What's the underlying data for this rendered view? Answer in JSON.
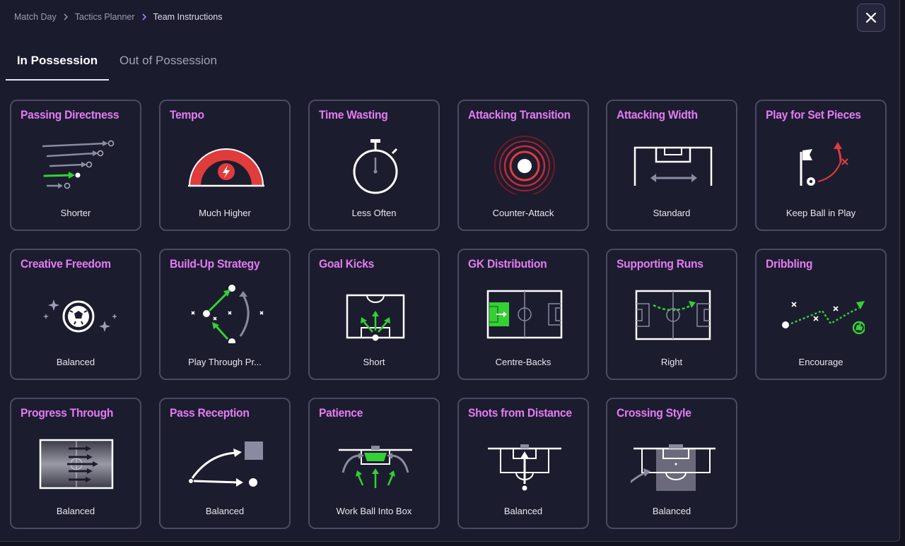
{
  "breadcrumb": [
    "Match Day",
    "Tactics Planner",
    "Team Instructions"
  ],
  "tabs": [
    {
      "label": "In Possession",
      "active": true
    },
    {
      "label": "Out of Possession",
      "active": false
    }
  ],
  "colors": {
    "accent": "#e27cf1",
    "green": "#33d133",
    "red": "#e03c3c",
    "background": "#1b1b2e"
  },
  "cards": [
    {
      "title": "Passing Directness",
      "value": "Shorter",
      "icon": "pass-arrows-icon"
    },
    {
      "title": "Tempo",
      "value": "Much Higher",
      "icon": "tempo-gauge-icon"
    },
    {
      "title": "Time Wasting",
      "value": "Less Often",
      "icon": "stopwatch-icon"
    },
    {
      "title": "Attacking Transition",
      "value": "Counter-Attack",
      "icon": "counter-attack-icon"
    },
    {
      "title": "Attacking Width",
      "value": "Standard",
      "icon": "width-icon"
    },
    {
      "title": "Play for Set Pieces",
      "value": "Keep Ball in Play",
      "icon": "set-piece-icon"
    },
    {
      "title": "Creative Freedom",
      "value": "Balanced",
      "icon": "creative-ball-icon"
    },
    {
      "title": "Build-Up Strategy",
      "value": "Play Through Pr...",
      "icon": "build-up-icon"
    },
    {
      "title": "Goal Kicks",
      "value": "Short",
      "icon": "goal-kick-icon"
    },
    {
      "title": "GK Distribution",
      "value": "Centre-Backs",
      "icon": "gk-distribution-icon"
    },
    {
      "title": "Supporting Runs",
      "value": "Right",
      "icon": "supporting-runs-icon"
    },
    {
      "title": "Dribbling",
      "value": "Encourage",
      "icon": "dribbling-icon"
    },
    {
      "title": "Progress Through",
      "value": "Balanced",
      "icon": "progress-through-icon"
    },
    {
      "title": "Pass Reception",
      "value": "Balanced",
      "icon": "pass-reception-icon"
    },
    {
      "title": "Patience",
      "value": "Work Ball Into Box",
      "icon": "patience-icon"
    },
    {
      "title": "Shots from Distance",
      "value": "Balanced",
      "icon": "shots-distance-icon"
    },
    {
      "title": "Crossing Style",
      "value": "Balanced",
      "icon": "crossing-style-icon"
    }
  ]
}
